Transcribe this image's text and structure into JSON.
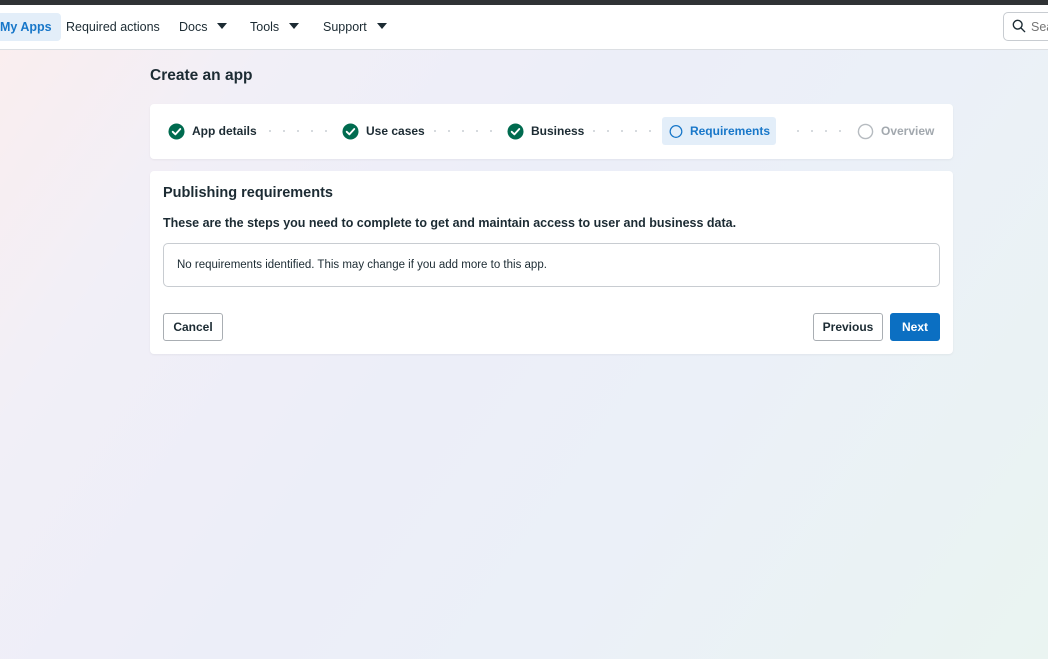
{
  "nav": {
    "items": [
      {
        "label": "My Apps",
        "active": true
      },
      {
        "label": "Required actions"
      },
      {
        "label": "Docs"
      },
      {
        "label": "Tools"
      },
      {
        "label": "Support"
      }
    ],
    "search_placeholder": "Search"
  },
  "page": {
    "title": "Create an app"
  },
  "stepper": {
    "steps": [
      {
        "label": "App details",
        "state": "done"
      },
      {
        "label": "Use cases",
        "state": "done"
      },
      {
        "label": "Business",
        "state": "done"
      },
      {
        "label": "Requirements",
        "state": "current"
      },
      {
        "label": "Overview",
        "state": "upcoming"
      }
    ]
  },
  "requirements": {
    "title": "Publishing requirements",
    "description": "These are the steps you need to complete to get and maintain access to user and business data.",
    "notice": "No requirements identified. This may change if you add more to this app."
  },
  "actions": {
    "cancel": "Cancel",
    "previous": "Previous",
    "next": "Next"
  },
  "colors": {
    "accent": "#1877c9",
    "primary_button": "#0b6fc2",
    "done_step": "#006b4f",
    "current_step_bg": "#e3eef9"
  }
}
